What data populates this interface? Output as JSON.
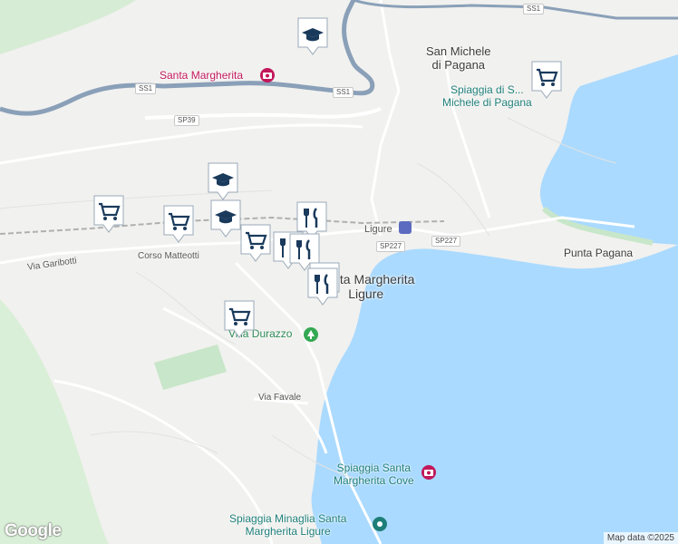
{
  "map": {
    "colors": {
      "land": "#f1f1ef",
      "sea": "#aadaff",
      "park": "#c8e6c9",
      "road_major": "#8aa0b8",
      "marker_fill": "#1a3a5c"
    },
    "labels": {
      "town_san_michele": "San Michele\ndi Pagana",
      "town_santa_margherita": "Santa Margherita\nLigure",
      "station": "Ligure",
      "punta_pagana": "Punta Pagana",
      "via_garibotti": "Via Garibotti",
      "corso_matteotti": "Corso Matteotti",
      "via_favale": "Via Favale",
      "villa_durazzo": "Villa Durazzo",
      "santa_margherita_poi": "Santa Margherita",
      "beach_san_michele": "Spiaggia di S...\nMichele di Pagana",
      "beach_cove": "Spiaggia Santa\nMargherita Cove",
      "beach_minaglia": "Spiaggia Minaglia Santa\nMargherita Ligure"
    },
    "shields": {
      "ss1_top": "SS1",
      "ss1_left": "SS1",
      "ss1_mid": "SS1",
      "sp39": "SP39",
      "sp227_a": "SP227",
      "sp227_b": "SP227"
    },
    "markers": [
      {
        "type": "school",
        "icon": "graduation-cap-icon"
      },
      {
        "type": "shop",
        "icon": "shopping-cart-icon"
      },
      {
        "type": "school",
        "icon": "graduation-cap-icon"
      },
      {
        "type": "school",
        "icon": "graduation-cap-icon"
      },
      {
        "type": "shop",
        "icon": "shopping-cart-icon"
      },
      {
        "type": "shop",
        "icon": "shopping-cart-icon"
      },
      {
        "type": "restaurant",
        "icon": "fork-knife-icon"
      },
      {
        "type": "restaurant",
        "icon": "fork-knife-icon"
      },
      {
        "type": "restaurant",
        "icon": "fork-knife-icon"
      },
      {
        "type": "restaurant",
        "icon": "fork-knife-icon"
      },
      {
        "type": "restaurant",
        "icon": "fork-knife-icon"
      },
      {
        "type": "shop",
        "icon": "shopping-cart-icon"
      },
      {
        "type": "shop",
        "icon": "shopping-cart-icon"
      }
    ],
    "footer": {
      "logo": "Google",
      "attribution": "Map data ©2025"
    }
  }
}
